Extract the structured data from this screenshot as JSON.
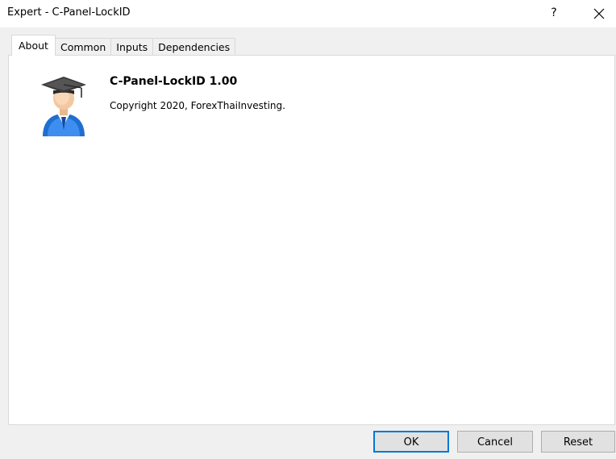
{
  "window": {
    "title": "Expert - C-Panel-LockID",
    "help_label": "?",
    "close_icon": "close-icon"
  },
  "tabs": [
    {
      "label": "About",
      "active": true
    },
    {
      "label": "Common",
      "active": false
    },
    {
      "label": "Inputs",
      "active": false
    },
    {
      "label": "Dependencies",
      "active": false
    }
  ],
  "about": {
    "icon": "graduate-user-icon",
    "product_name": "C-Panel-LockID 1.00",
    "copyright": "Copyright 2020, ForexThaiInvesting."
  },
  "buttons": {
    "ok": "OK",
    "cancel": "Cancel",
    "reset": "Reset"
  },
  "colors": {
    "accent": "#0078d7",
    "panel_bg": "#ffffff",
    "dialog_bg": "#f0f0f0",
    "icon_blue": "#1f6fd1"
  }
}
